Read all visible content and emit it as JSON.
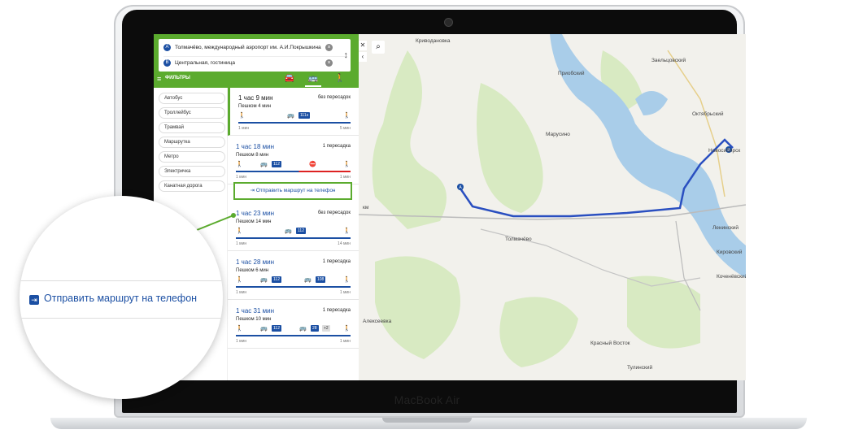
{
  "device": {
    "brand": "MacBook Air"
  },
  "search": {
    "point_a_marker": "A",
    "point_a": "Толмачёво, международный аэропорт им. А.И.Покрышкина",
    "point_b_marker": "B",
    "point_b": "Центральная, гостиница"
  },
  "filter_bar": {
    "label": "ФИЛЬТРЫ"
  },
  "transport_filters": [
    "Автобус",
    "Троллейбус",
    "Трамвай",
    "Маршрутка",
    "Метро",
    "Электричка",
    "Канатная дорога"
  ],
  "routes": [
    {
      "time": "1 час 9 мин",
      "transfers": "без пересадок",
      "walk": "Пешком 4 мин",
      "badges": [
        "111э"
      ],
      "mins": [
        "1 мин",
        "5 мин"
      ]
    },
    {
      "time": "1 час 18 мин",
      "transfers": "1 пересадка",
      "walk": "Пешком 8 мин",
      "badges": [
        "112"
      ],
      "mins": [
        "1 мин",
        "1 мин"
      ]
    },
    {
      "time": "1 час 23 мин",
      "transfers": "без пересадок",
      "walk": "Пешком 14 мин",
      "badges": [
        "112"
      ],
      "mins": [
        "1 мин",
        "14 мин"
      ]
    },
    {
      "time": "1 час 28 мин",
      "transfers": "1 пересадка",
      "walk": "Пешком 6 мин",
      "badges": [
        "112",
        "108"
      ],
      "mins": [
        "1 мин",
        "1 мин"
      ]
    },
    {
      "time": "1 час 31 мин",
      "transfers": "1 пересадка",
      "walk": "Пешком 10 мин",
      "badges": [
        "112",
        "28",
        "+2"
      ],
      "mins": [
        "1 мин",
        "1 мин"
      ]
    }
  ],
  "send_button": {
    "label": "Отправить маршрут на телефон"
  },
  "magnifier": {
    "label": "Отправить маршрут на телефон"
  },
  "map": {
    "places": [
      "Криводановка",
      "Заельцовский",
      "Приобский",
      "Марусино",
      "Толмачёво",
      "Алексеевка",
      "Красный Восток",
      "Тулинский",
      "Кировский",
      "Новосибирск",
      "Октябрьский",
      "Ленинский",
      "Коченёвский"
    ],
    "road_label": "км",
    "marker_a": "A",
    "marker_b": "B"
  },
  "colors": {
    "accent_green": "#5bab2e",
    "route_blue": "#1b4fa3"
  }
}
